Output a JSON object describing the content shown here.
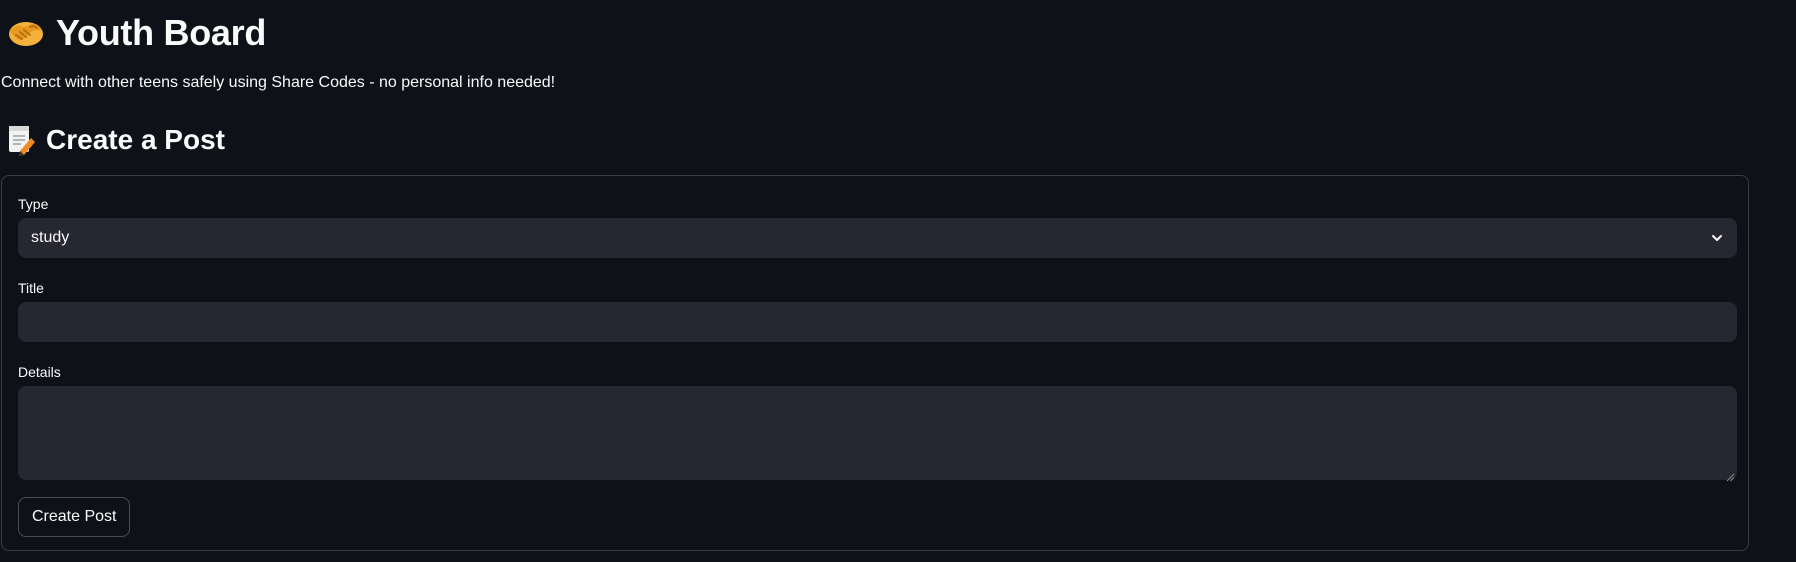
{
  "header": {
    "icon": "handshake-icon",
    "title": "Youth Board",
    "subtitle": "Connect with other teens safely using Share Codes - no personal info needed!"
  },
  "create_post": {
    "icon": "memo-icon",
    "heading": "Create a Post",
    "type_label": "Type",
    "type_value": "study",
    "title_label": "Title",
    "title_value": "",
    "details_label": "Details",
    "details_value": "",
    "submit_label": "Create Post"
  },
  "colors": {
    "background": "#0e1117",
    "input_background": "#262730",
    "border": "#3b3d45",
    "text": "#fafafa"
  }
}
